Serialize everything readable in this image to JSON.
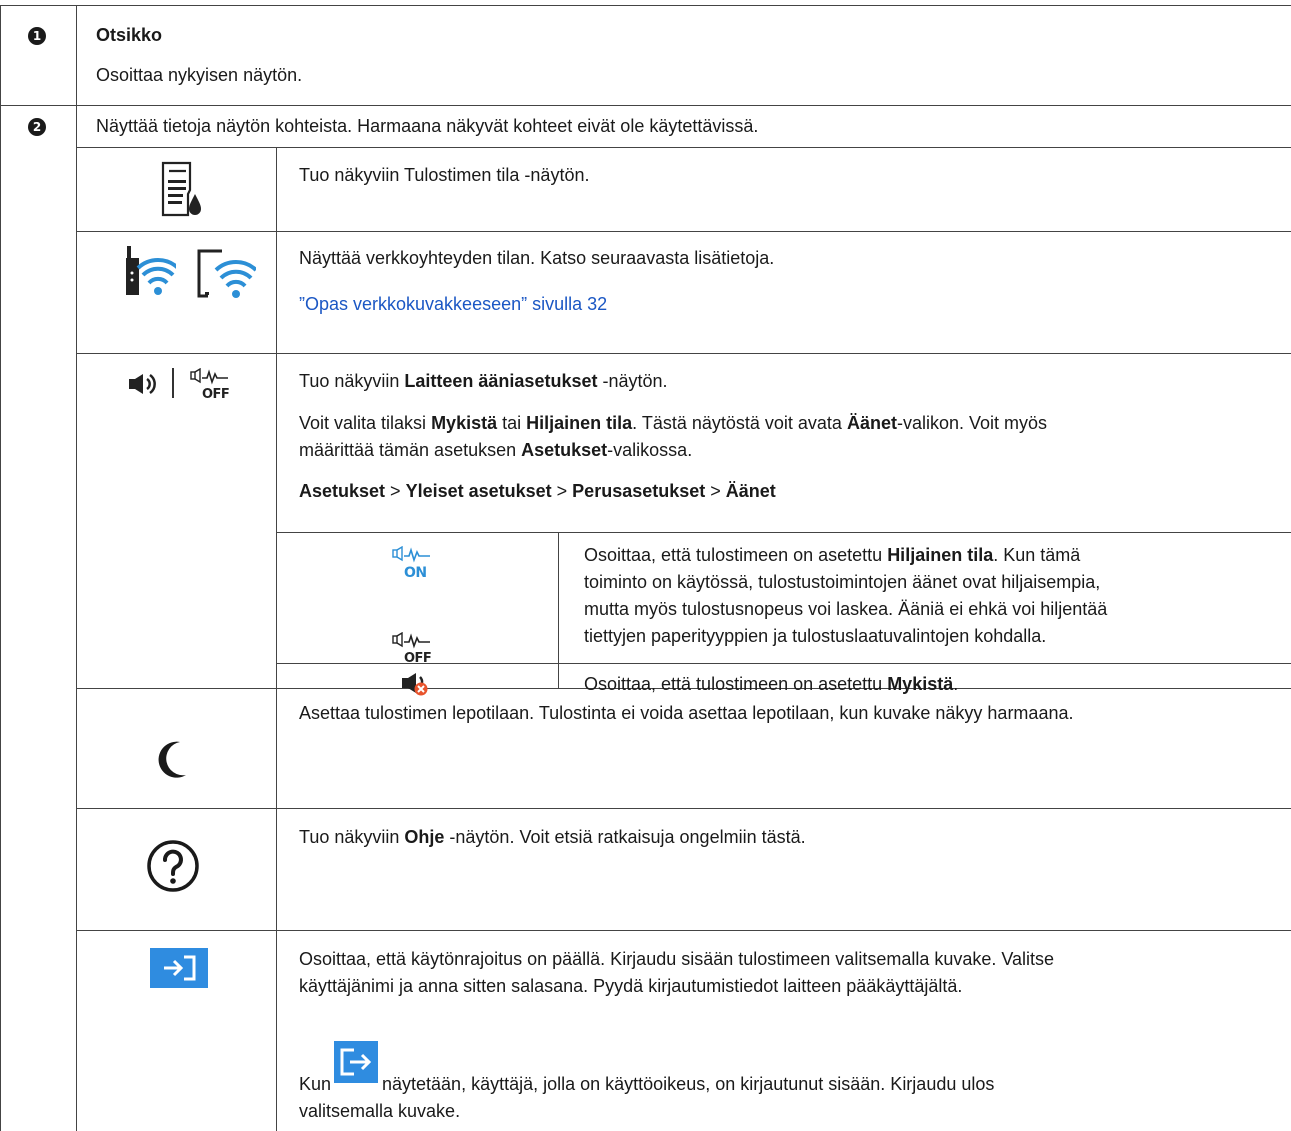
{
  "row1": {
    "marker": "1",
    "title": "Otsikko",
    "text": "Osoittaa nykyisen näytön."
  },
  "row2": {
    "marker": "2",
    "intro": "Näyttää tietoja näytön kohteista. Harmaana näkyvät kohteet eivät ole käytettävissä."
  },
  "status_row": {
    "icon": "printer-status-ink-icon",
    "text": "Tuo näkyviin Tulostimen tila -näytön."
  },
  "network_row": {
    "icons": [
      "wifi-router-icon",
      "wifi-direct-phone-icon"
    ],
    "text": "Näyttää verkkoyhteyden tilan. Katso seuraavasta lisätietoja.",
    "link": "”Opas verkkokuvakkeeseen” sivulla 32"
  },
  "sound_row": {
    "icons": [
      "speaker-icon",
      "quiet-mode-off-icon"
    ],
    "line1_pre": "Tuo näkyviin ",
    "line1_bold": "Laitteen ääniasetukset",
    "line1_post": " -näytön.",
    "line2": {
      "a": "Voit valita tilaksi ",
      "b": "Mykistä",
      "c": " tai ",
      "d": "Hiljainen tila",
      "e": ". Tästä näytöstä voit avata ",
      "f": "Äänet",
      "g": "-valikon. Voit myös"
    },
    "line3": {
      "a": "määrittää tämän asetuksen ",
      "b": "Asetukset",
      "c": "-valikossa."
    },
    "path": {
      "p1": "Asetukset",
      "sep": " > ",
      "p2": "Yleiset asetukset",
      "p3": "Perusasetukset",
      "p4": "Äänet"
    },
    "quiet": {
      "icon_on_label": "ON",
      "icon_off_label": "OFF",
      "l1_pre": "Osoittaa, että tulostimeen on asetettu ",
      "l1_bold": "Hiljainen tila",
      "l1_post": ". Kun tämä",
      "l2": "toiminto on käytössä, tulostustoimintojen äänet ovat hiljaisempia,",
      "l3": "mutta myös tulostusnopeus voi laskea. Ääniä ei ehkä voi hiljentää",
      "l4": "tiettyjen paperityyppien ja tulostuslaatuvalintojen kohdalla."
    },
    "mute": {
      "icon": "mute-speaker-icon",
      "pre": "Osoittaa, että tulostimeen on asetettu ",
      "bold": "Mykistä",
      "post": "."
    }
  },
  "sleep_row": {
    "icon": "moon-icon",
    "text": "Asettaa tulostimen lepotilaan. Tulostinta ei voida asettaa lepotilaan, kun kuvake näkyy harmaana."
  },
  "help_row": {
    "icon": "help-icon",
    "pre": "Tuo näkyviin ",
    "bold": "Ohje",
    "post": " -näytön. Voit etsiä ratkaisuja ongelmiin tästä."
  },
  "login_row": {
    "icon": "login-icon",
    "l1": "Osoittaa, että käytönrajoitus on päällä. Kirjaudu sisään tulostimeen valitsemalla kuvake. Valitse",
    "l2": "käyttäjänimi ja anna sitten salasana. Pyydä kirjautumistiedot laitteen pääkäyttäjältä.",
    "l3_pre": "Kun",
    "l3_post": "näytetään, käyttäjä, jolla on käyttöoikeus, on kirjautunut sisään. Kirjaudu ulos",
    "l4": "valitsemalla kuvake."
  },
  "colors": {
    "wifi_blue": "#2c8fd6",
    "link_blue": "#1b57c4",
    "login_blue": "#2f8ce0",
    "mute_orange": "#e8542d"
  }
}
